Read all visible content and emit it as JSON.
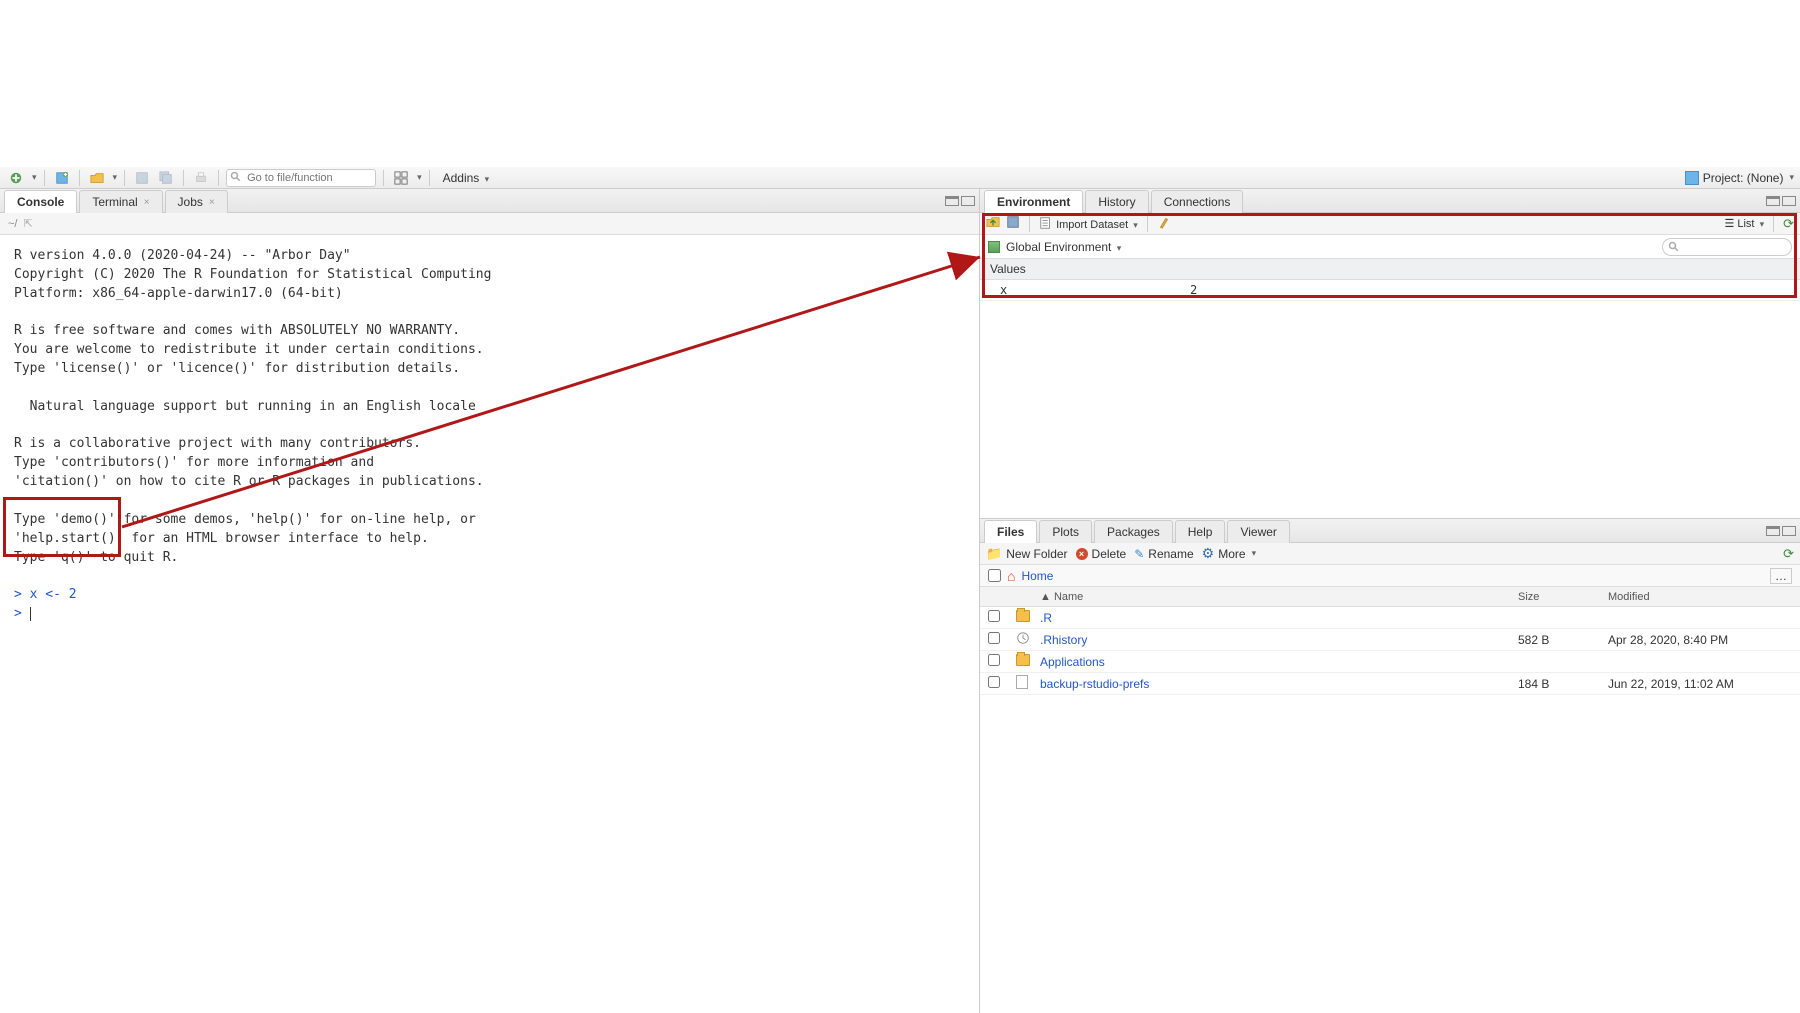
{
  "toolbar": {
    "goto_placeholder": "Go to file/function",
    "addins_label": "Addins",
    "project_label": "Project: (None)"
  },
  "left": {
    "tabs": [
      {
        "label": "Console",
        "active": true,
        "closable": false
      },
      {
        "label": "Terminal",
        "active": false,
        "closable": true
      },
      {
        "label": "Jobs",
        "active": false,
        "closable": true
      }
    ],
    "path": "~/",
    "console_text": "R version 4.0.0 (2020-04-24) -- \"Arbor Day\"\nCopyright (C) 2020 The R Foundation for Statistical Computing\nPlatform: x86_64-apple-darwin17.0 (64-bit)\n\nR is free software and comes with ABSOLUTELY NO WARRANTY.\nYou are welcome to redistribute it under certain conditions.\nType 'license()' or 'licence()' for distribution details.\n\n  Natural language support but running in an English locale\n\nR is a collaborative project with many contributors.\nType 'contributors()' for more information and\n'citation()' on how to cite R or R packages in publications.\n\nType 'demo()' for some demos, 'help()' for on-line help, or\n'help.start()' for an HTML browser interface to help.\nType 'q()' to quit R.\n",
    "prompt_line": "> x <- 2",
    "prompt_empty": "> "
  },
  "env": {
    "tabs": [
      {
        "label": "Environment",
        "active": true
      },
      {
        "label": "History",
        "active": false
      },
      {
        "label": "Connections",
        "active": false
      }
    ],
    "import_label": "Import Dataset",
    "list_label": "List",
    "scope_label": "Global Environment",
    "section": "Values",
    "vars": [
      {
        "name": "x",
        "value": "2"
      }
    ]
  },
  "files": {
    "tabs": [
      {
        "label": "Files",
        "active": true
      },
      {
        "label": "Plots",
        "active": false
      },
      {
        "label": "Packages",
        "active": false
      },
      {
        "label": "Help",
        "active": false
      },
      {
        "label": "Viewer",
        "active": false
      }
    ],
    "newfolder_label": "New Folder",
    "delete_label": "Delete",
    "rename_label": "Rename",
    "more_label": "More",
    "home_label": "Home",
    "cols": {
      "name": "Name",
      "size": "Size",
      "modified": "Modified"
    },
    "rows": [
      {
        "icon": "folder",
        "name": ".R",
        "size": "",
        "modified": ""
      },
      {
        "icon": "rhist",
        "name": ".Rhistory",
        "size": "582 B",
        "modified": "Apr 28, 2020, 8:40 PM"
      },
      {
        "icon": "folder",
        "name": "Applications",
        "size": "",
        "modified": ""
      },
      {
        "icon": "file",
        "name": "backup-rstudio-prefs",
        "size": "184 B",
        "modified": "Jun 22, 2019, 11:02 AM"
      }
    ]
  }
}
